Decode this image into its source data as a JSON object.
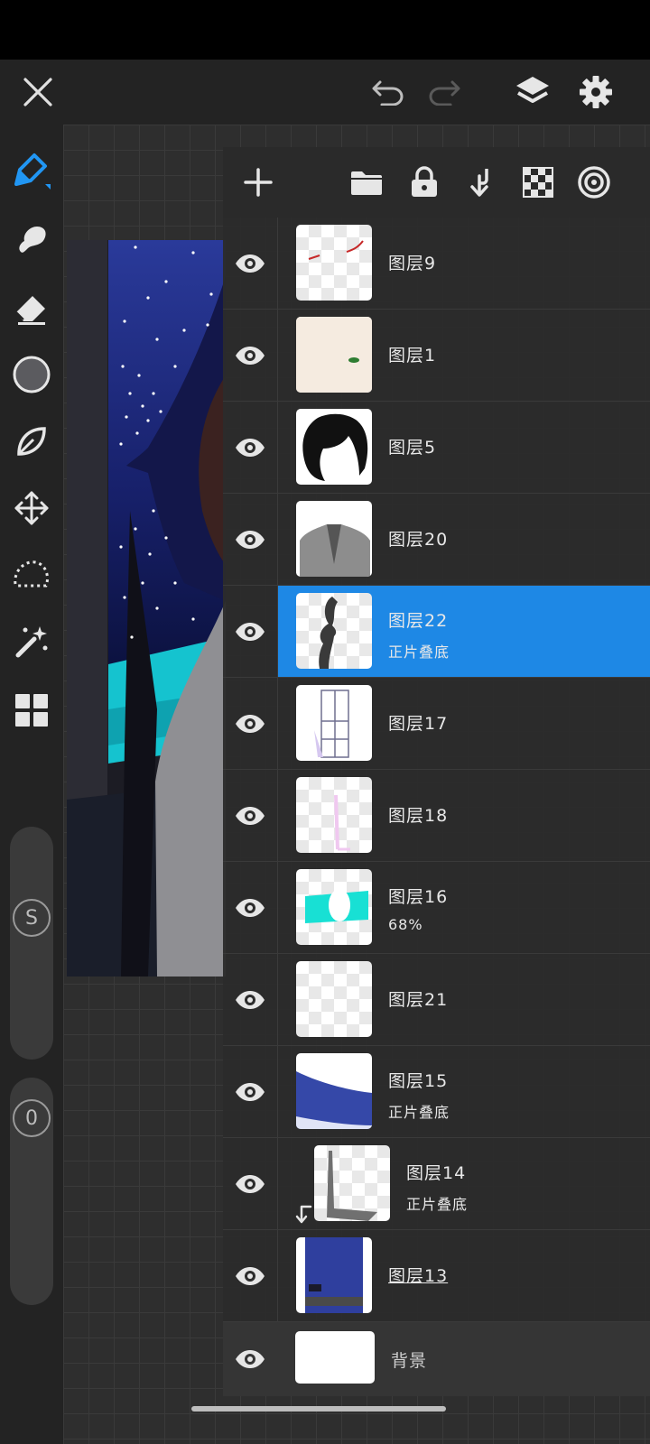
{
  "colors": {
    "accent": "#1e88e5",
    "toolbar_bg": "#232323",
    "panel_bg": "#2c2c2c"
  },
  "topbar": {
    "close_icon": "close-icon",
    "undo_icon": "undo-icon",
    "redo_icon": "redo-icon",
    "layers_icon": "layers-icon",
    "settings_icon": "gear-icon"
  },
  "tools": [
    "pen",
    "smudge",
    "eraser",
    "color",
    "leaf-brush",
    "transform",
    "lasso",
    "magic-wand",
    "gallery"
  ],
  "sliders": {
    "size_label": "S",
    "opacity_label": "0"
  },
  "layer_panel": {
    "toolbar_icons": [
      "add-icon",
      "folder-icon",
      "lock-icon",
      "merge-down-icon",
      "alpha-lock-icon",
      "reference-icon"
    ],
    "layers": [
      {
        "name": "图层9",
        "sub": "",
        "selected": false,
        "clipped": false,
        "underline": false
      },
      {
        "name": "图层1",
        "sub": "",
        "selected": false,
        "clipped": false,
        "underline": false
      },
      {
        "name": "图层5",
        "sub": "",
        "selected": false,
        "clipped": false,
        "underline": false
      },
      {
        "name": "图层20",
        "sub": "",
        "selected": false,
        "clipped": false,
        "underline": false
      },
      {
        "name": "图层22",
        "sub": "正片叠底",
        "selected": true,
        "clipped": false,
        "underline": false
      },
      {
        "name": "图层17",
        "sub": "",
        "selected": false,
        "clipped": false,
        "underline": false
      },
      {
        "name": "图层18",
        "sub": "",
        "selected": false,
        "clipped": false,
        "underline": false
      },
      {
        "name": "图层16",
        "sub": "68%",
        "selected": false,
        "clipped": false,
        "underline": false
      },
      {
        "name": "图层21",
        "sub": "",
        "selected": false,
        "clipped": false,
        "underline": false
      },
      {
        "name": "图层15",
        "sub": "正片叠底",
        "selected": false,
        "clipped": false,
        "underline": false
      },
      {
        "name": "图层14",
        "sub": "正片叠底",
        "selected": false,
        "clipped": true,
        "underline": false
      },
      {
        "name": "图层13",
        "sub": "",
        "selected": false,
        "clipped": false,
        "underline": true
      }
    ],
    "background_layer": {
      "name": "背景"
    }
  }
}
